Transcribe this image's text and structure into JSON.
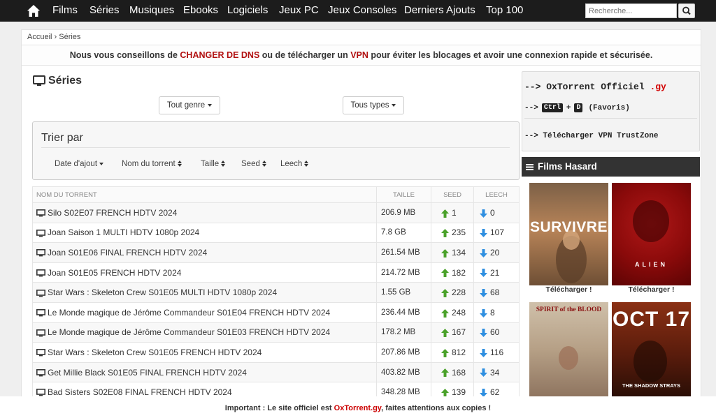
{
  "nav": {
    "items": [
      "Films",
      "Séries",
      "Musiques",
      "Ebooks",
      "Logiciels",
      "Jeux PC",
      "Jeux Consoles",
      "Derniers Ajouts",
      "Top 100"
    ],
    "search_placeholder": "Recherche..."
  },
  "breadcrumb": "Accueil › Séries",
  "notice": {
    "before": "Nous vous conseillons de ",
    "dns": "CHANGER DE DNS",
    "middle": " ou de télécharger un ",
    "vpn": "VPN",
    "after": " pour éviter les blocages et avoir une connexion rapide et sécurisée."
  },
  "section_title": "Séries",
  "filters": {
    "genre": "Tout genre",
    "type": "Tous types"
  },
  "sort": {
    "title": "Trier par",
    "options": [
      "Date d'ajout",
      "Nom du torrent",
      "Taille",
      "Seed",
      "Leech"
    ]
  },
  "table": {
    "headers": [
      "NOM DU TORRENT",
      "TAILLE",
      "SEED",
      "LEECH"
    ],
    "rows": [
      {
        "name": "Silo S02E07 FRENCH HDTV 2024",
        "size": "206.9 MB",
        "seed": "1",
        "leech": "0"
      },
      {
        "name": "Joan Saison 1 MULTI HDTV 1080p 2024",
        "size": "7.8 GB",
        "seed": "235",
        "leech": "107"
      },
      {
        "name": "Joan S01E06 FINAL FRENCH HDTV 2024",
        "size": "261.54 MB",
        "seed": "134",
        "leech": "20"
      },
      {
        "name": "Joan S01E05 FRENCH HDTV 2024",
        "size": "214.72 MB",
        "seed": "182",
        "leech": "21"
      },
      {
        "name": "Star Wars : Skeleton Crew S01E05 MULTI HDTV 1080p 2024",
        "size": "1.55 GB",
        "seed": "228",
        "leech": "68"
      },
      {
        "name": "Le Monde magique de Jérôme Commandeur S01E04 FRENCH HDTV 2024",
        "size": "236.44 MB",
        "seed": "248",
        "leech": "8"
      },
      {
        "name": "Le Monde magique de Jérôme Commandeur S01E03 FRENCH HDTV 2024",
        "size": "178.2 MB",
        "seed": "167",
        "leech": "60"
      },
      {
        "name": "Star Wars : Skeleton Crew S01E05 FRENCH HDTV 2024",
        "size": "207.86 MB",
        "seed": "812",
        "leech": "116"
      },
      {
        "name": "Get Millie Black S01E05 FINAL FRENCH HDTV 2024",
        "size": "403.82 MB",
        "seed": "168",
        "leech": "34"
      },
      {
        "name": "Bad Sisters S02E08 FINAL FRENCH HDTV 2024",
        "size": "348.28 MB",
        "seed": "139",
        "leech": "62"
      }
    ]
  },
  "sidebar": {
    "official_prefix": "--> ",
    "official_name": "OxTorrent Officiel ",
    "official_tld": ".gy",
    "shortcut_prefix": "--> ",
    "key_ctrl": "Ctrl",
    "plus": "+",
    "key_d": "D",
    "favoris": "(Favoris)",
    "vpn_line": "--> Télécharger VPN TrustZone",
    "films_title": "Films Hasard",
    "posters": [
      {
        "title": "SURVIVRE",
        "download": "Télécharger !"
      },
      {
        "title": "ALIEN",
        "download": "Télécharger !"
      },
      {
        "title": "SPIRIT of the BLOOD"
      },
      {
        "title": "OCT 17",
        "subtitle": "THE SHADOW STRAYS"
      }
    ]
  },
  "footer": {
    "before": "Important : Le site officiel est ",
    "site": "OxTorrent.gy",
    "after": ", faites attentions aux copies !"
  }
}
